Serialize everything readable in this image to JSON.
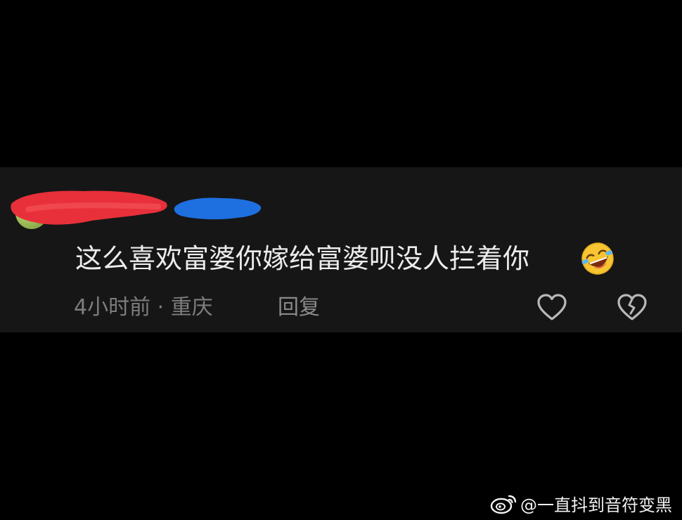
{
  "comment": {
    "text": "这么喜欢富婆你嫁给富婆呗没人拦着你",
    "emoji": "rolling-on-floor-laughing-emoji",
    "meta": "4小时前 · 重庆",
    "reply_label": "回复",
    "like_icon": "heart-outline-icon",
    "dislike_icon": "broken-heart-icon"
  },
  "colors": {
    "background": "#000000",
    "card": "#161616",
    "text": "#ececec",
    "meta_text": "#7d7d7d",
    "redact_red": "#e8303a",
    "redact_blue": "#1e6fe0"
  },
  "watermark": {
    "logo": "weibo-logo",
    "text": "@一直抖到音符变黑"
  }
}
